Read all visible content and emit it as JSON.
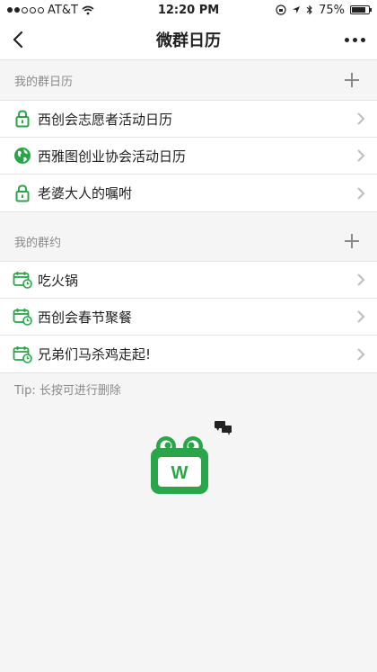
{
  "status": {
    "carrier": "AT&T",
    "time": "12:20 PM",
    "battery": "75%",
    "battery_level": 0.75
  },
  "nav": {
    "title": "微群日历"
  },
  "sections": {
    "calendars": {
      "title": "我的群日历",
      "items": [
        {
          "label": "西创会志愿者活动日历",
          "icon": "lock-icon"
        },
        {
          "label": "西雅图创业协会活动日历",
          "icon": "globe-icon"
        },
        {
          "label": "老婆大人的嘱咐",
          "icon": "lock-icon"
        }
      ]
    },
    "events": {
      "title": "我的群约",
      "items": [
        {
          "label": "吃火锅",
          "icon": "calendar-clock-icon"
        },
        {
          "label": "西创会春节聚餐",
          "icon": "calendar-clock-icon"
        },
        {
          "label": "兄弟们马杀鸡走起!",
          "icon": "calendar-clock-icon"
        }
      ]
    }
  },
  "tip": "Tip: 长按可进行删除",
  "logo": {
    "letter": "W",
    "color": "#2aa64a"
  }
}
